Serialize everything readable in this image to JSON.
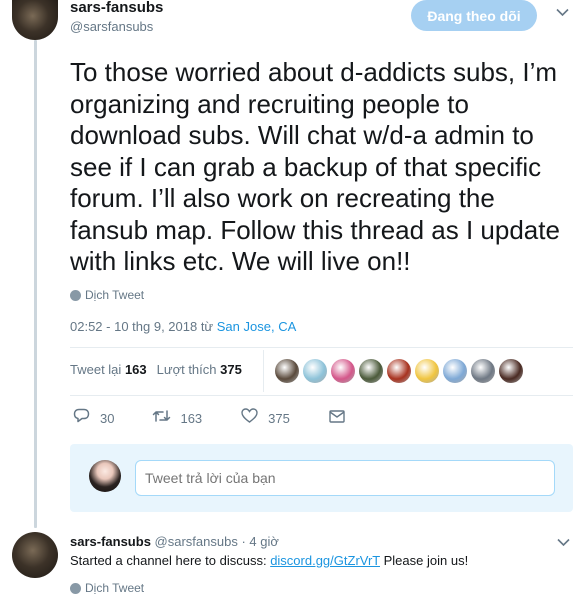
{
  "header": {
    "name": "sars-fansubs",
    "handle": "@sarsfansubs",
    "follow_label": "Đang theo dõi"
  },
  "tweet": {
    "text": "To those worried about d-addicts subs, I’m organizing and recruiting people to download subs. Will chat w/d-a admin to see if I can grab a backup of that specific forum. I’ll also work on recreating the fansub map. Follow this thread as I update with links etc. We will live on!!",
    "translate_label": "Dịch Tweet",
    "time_text": "02:52 - 10 thg 9, 2018 từ",
    "location": "San Jose, CA"
  },
  "stats": {
    "retweets_label": "Tweet lại",
    "retweets": "163",
    "likes_label": "Lượt thích",
    "likes": "375"
  },
  "likers": [
    "#5a4a3c",
    "#8ec3d9",
    "#d4578a",
    "#4b5a3a",
    "#a8321f",
    "#f0c540",
    "#7fa9d6",
    "#6f7884",
    "#4a2a22"
  ],
  "actions": {
    "reply_count": "30",
    "retweet_count": "163",
    "like_count": "375"
  },
  "reply": {
    "placeholder": "Tweet trả lời của bạn"
  },
  "second_tweet": {
    "name": "sars-fansubs",
    "meta": "@sarsfansubs · 4 giờ",
    "text_before": "Started a channel here to discuss:",
    "link": "discord.gg/GtZrVrT",
    "text_after": "Please join us!",
    "translate_label": "Dịch Tweet"
  }
}
